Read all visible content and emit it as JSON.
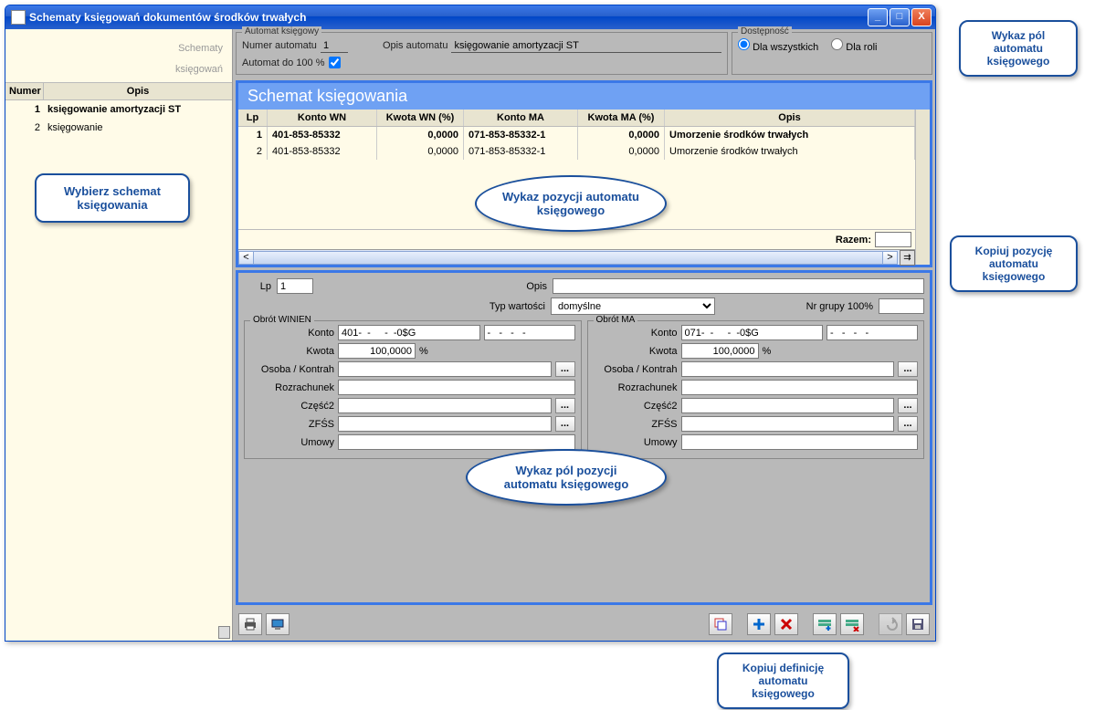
{
  "window": {
    "title": "Schematy księgowań dokumentów środków trwałych"
  },
  "sidebar": {
    "title1": "Schematy",
    "title2": "księgowań",
    "col_num": "Numer",
    "col_op": "Opis",
    "rows": [
      {
        "n": "1",
        "t": "księgowanie amortyzacji ST"
      },
      {
        "n": "2",
        "t": "księgowanie"
      }
    ]
  },
  "automat": {
    "legend": "Automat księgowy",
    "l_numer": "Numer automatu",
    "numer": "1",
    "l_opis": "Opis automatu",
    "opis": "księgowanie amortyzacji ST",
    "l_100": "Automat do 100 %"
  },
  "dostep": {
    "legend": "Dostępność",
    "r1": "Dla wszystkich",
    "r2": "Dla roli"
  },
  "grid": {
    "title": "Schemat księgowania",
    "h_lp": "Lp",
    "h_kwn": "Konto WN",
    "h_wn": "Kwota WN (%)",
    "h_kma": "Konto MA",
    "h_ma": "Kwota MA (%)",
    "h_op": "Opis",
    "rows": [
      {
        "lp": "1",
        "kwn": "401-853-85332",
        "wn": "0,0000",
        "kma": "071-853-85332-1",
        "ma": "0,0000",
        "op": "Umorzenie środków trwałych"
      },
      {
        "lp": "2",
        "kwn": "401-853-85332",
        "wn": "0,0000",
        "kma": "071-853-85332-1",
        "ma": "0,0000",
        "op": "Umorzenie środków trwałych"
      }
    ],
    "razem": "Razem:"
  },
  "detail": {
    "l_lp": "Lp",
    "lp": "1",
    "l_opis": "Opis",
    "opis": "",
    "l_typ": "Typ wartości",
    "typ": "domyślne",
    "l_nrg": "Nr grupy 100%",
    "nrg": "",
    "wn": {
      "legend": "Obrót WINIEN",
      "l_konto": "Konto",
      "konto": "401-  -     -  -0$G",
      "konto2": "-   -   -   -",
      "l_kwota": "Kwota",
      "kwota": "100,0000",
      "pct": "%",
      "l_osoba": "Osoba / Kontrah",
      "l_roz": "Rozrachunek",
      "l_cz": "Część2",
      "l_zfss": "ZFŚS",
      "l_um": "Umowy"
    },
    "ma": {
      "legend": "Obrót MA",
      "l_konto": "Konto",
      "konto": "071-  -     -  -0$G",
      "konto2": "-   -   -   -",
      "l_kwota": "Kwota",
      "kwota": "100,0000",
      "pct": "%",
      "l_osoba": "Osoba / Kontrah",
      "l_roz": "Rozrachunek",
      "l_cz": "Część2",
      "l_zfss": "ZFŚS",
      "l_um": "Umowy"
    }
  },
  "callouts": {
    "c1": "Wybierz schemat księgowania",
    "c2": "Wykaz pozycji automatu księgowego",
    "c3": "Wykaz pól pozycji automatu księgowego",
    "c4": "Wykaz pól automatu księgowego",
    "c5": "Kopiuj pozycję automatu księgowego",
    "c6": "Kopiuj definicję automatu księgowego"
  }
}
